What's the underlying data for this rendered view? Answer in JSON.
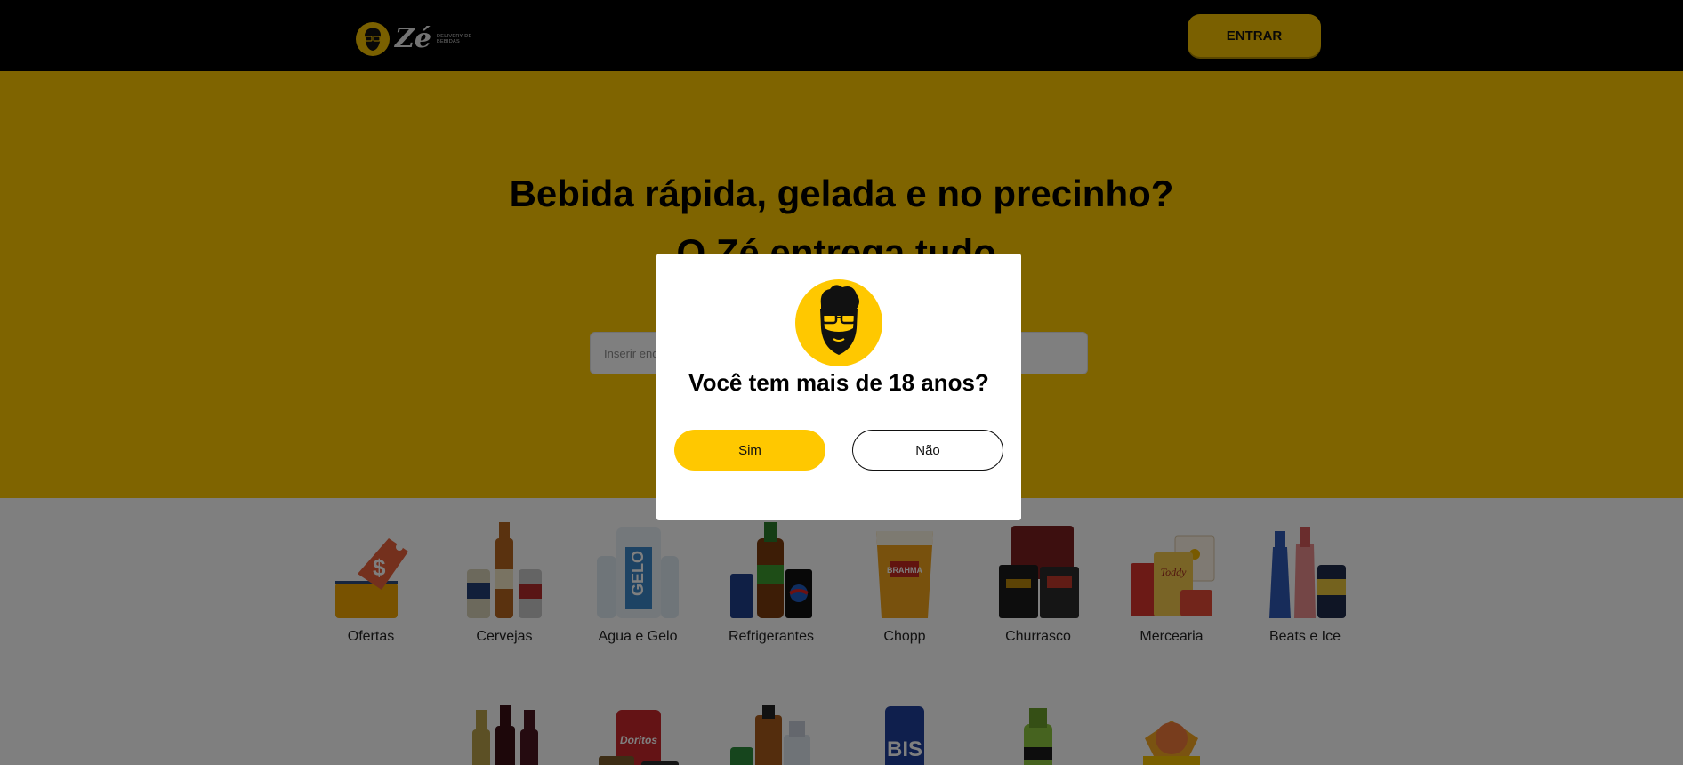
{
  "header": {
    "logo_wordmark": "Zé",
    "logo_tagline": "Delivery de bebidas",
    "enter_label": "ENTRAR"
  },
  "hero": {
    "title_line1": "Bebida rápida, gelada e no precinho?",
    "title_line2": "O Zé entrega tudo.",
    "search_placeholder": "Inserir endereço para ver preço"
  },
  "categories": {
    "row1": [
      {
        "label": "Ofertas",
        "icon": "offer-tag-basket-icon"
      },
      {
        "label": "Cervejas",
        "icon": "beer-bottles-icon"
      },
      {
        "label": "Agua e Gelo",
        "icon": "ice-water-icon"
      },
      {
        "label": "Refrigerantes",
        "icon": "soda-bottles-icon"
      },
      {
        "label": "Chopp",
        "icon": "draft-beer-glass-icon"
      },
      {
        "label": "Churrasco",
        "icon": "barbecue-meat-icon"
      },
      {
        "label": "Mercearia",
        "icon": "grocery-items-icon"
      },
      {
        "label": "Beats e Ice",
        "icon": "beats-ice-bottles-icon"
      }
    ],
    "row2_icons": [
      "wine-bottles-icon",
      "doritos-snacks-icon",
      "spirits-bottles-icon",
      "biscuit-icon",
      "energy-drink-icon",
      "party-balloons-icon"
    ]
  },
  "modal": {
    "question": "Você tem mais de 18 anos?",
    "yes_label": "Sim",
    "no_label": "Não"
  },
  "colors": {
    "brand_yellow": "#ffc800",
    "header_black": "#000000",
    "overlay": "rgba(0,0,0,0.5)"
  }
}
